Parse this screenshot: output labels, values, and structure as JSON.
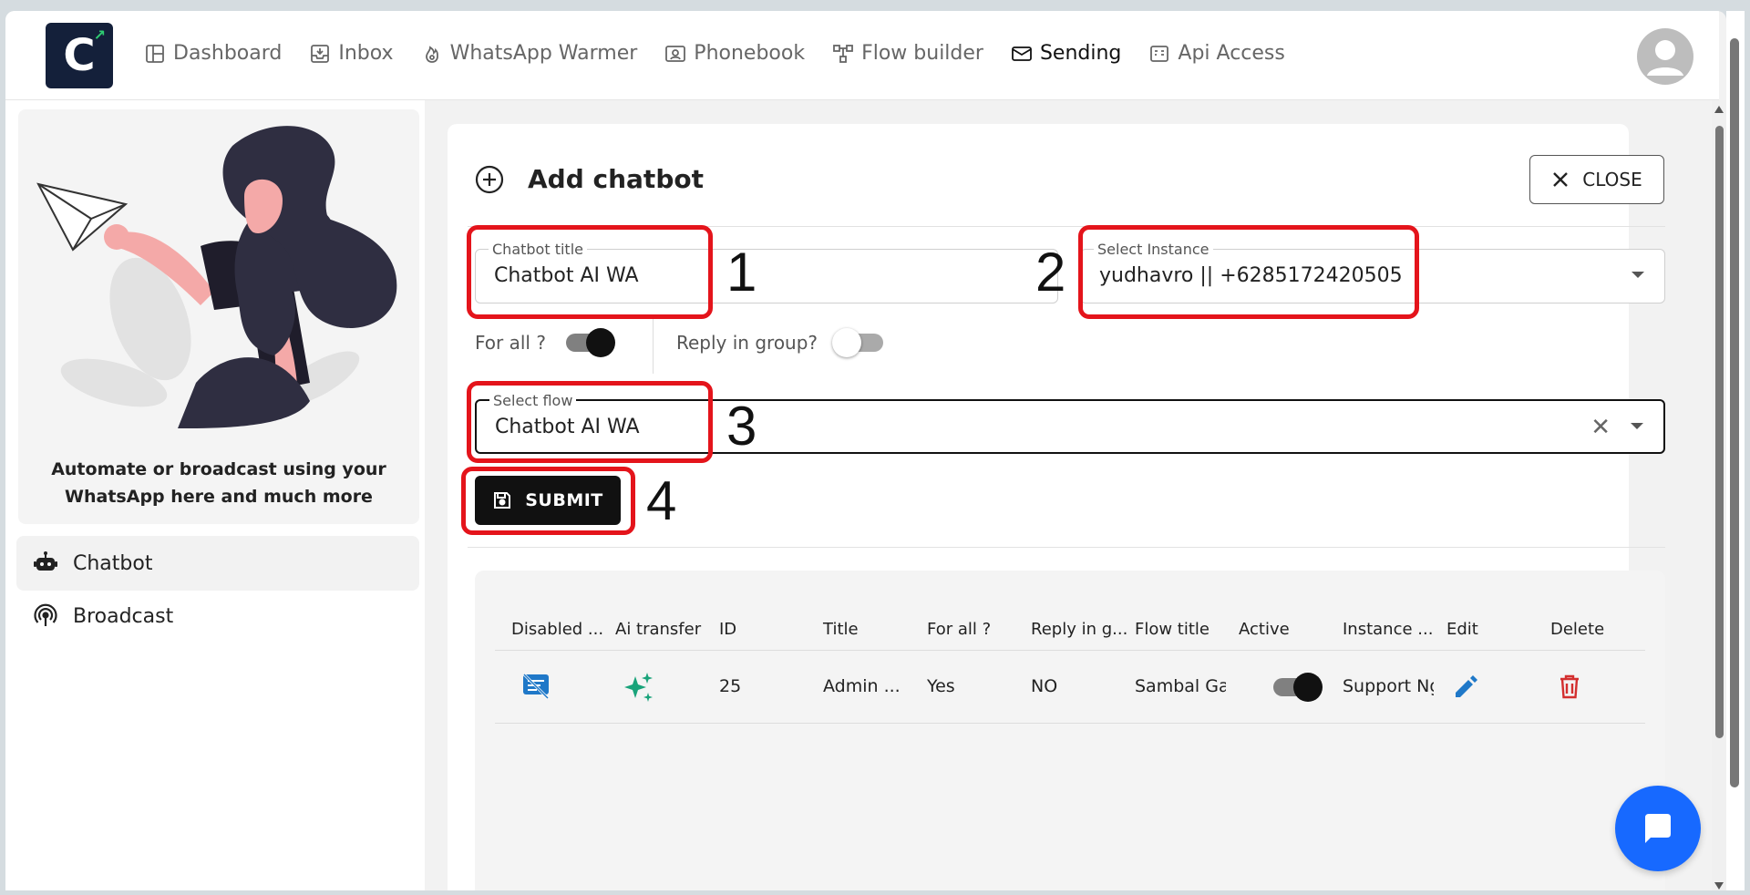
{
  "header": {
    "logo_letter": "C",
    "nav": [
      {
        "label": "Dashboard",
        "icon": "dashboard-icon"
      },
      {
        "label": "Inbox",
        "icon": "inbox-icon"
      },
      {
        "label": "WhatsApp Warmer",
        "icon": "flame-icon"
      },
      {
        "label": "Phonebook",
        "icon": "contacts-icon"
      },
      {
        "label": "Flow builder",
        "icon": "flow-icon"
      },
      {
        "label": "Sending",
        "icon": "mail-icon"
      },
      {
        "label": "Api Access",
        "icon": "api-icon"
      }
    ],
    "active_nav": "Sending"
  },
  "sidebar": {
    "tagline": "Automate or broadcast using your WhatsApp here and much more",
    "items": [
      {
        "label": "Chatbot",
        "icon": "robot-icon",
        "active": true
      },
      {
        "label": "Broadcast",
        "icon": "broadcast-icon",
        "active": false
      }
    ]
  },
  "form": {
    "title": "Add chatbot",
    "close_label": "CLOSE",
    "chatbot_title": {
      "label": "Chatbot title",
      "value": "Chatbot AI WA"
    },
    "instance": {
      "label": "Select Instance",
      "value": "yudhavro || +6285172420505"
    },
    "for_all": {
      "label": "For all ?",
      "on": true
    },
    "reply_in_group": {
      "label": "Reply in group?",
      "on": false
    },
    "flow": {
      "label": "Select flow",
      "value": "Chatbot AI WA"
    },
    "submit_label": "SUBMIT"
  },
  "annotations": [
    "1",
    "2",
    "3",
    "4"
  ],
  "table": {
    "headers": [
      "Disabled ...",
      "Ai transfer",
      "ID",
      "Title",
      "For all ?",
      "Reply in g...",
      "Flow title",
      "Active",
      "Instance ...",
      "Edit",
      "Delete"
    ],
    "rows": [
      {
        "id": "25",
        "title": "Admin ...",
        "for_all": "Yes",
        "reply_in_group": "NO",
        "flow_title": "Sambal Gan",
        "active": true,
        "instance": "Support Ng"
      }
    ]
  },
  "colors": {
    "accent_dark": "#111111",
    "annotation_red": "#e4141b",
    "fab_blue": "#1769ff",
    "ai_green": "#19a37a",
    "edit_blue": "#1f78c8",
    "delete_red": "#d32f2f",
    "logo_bg": "#14203a"
  }
}
